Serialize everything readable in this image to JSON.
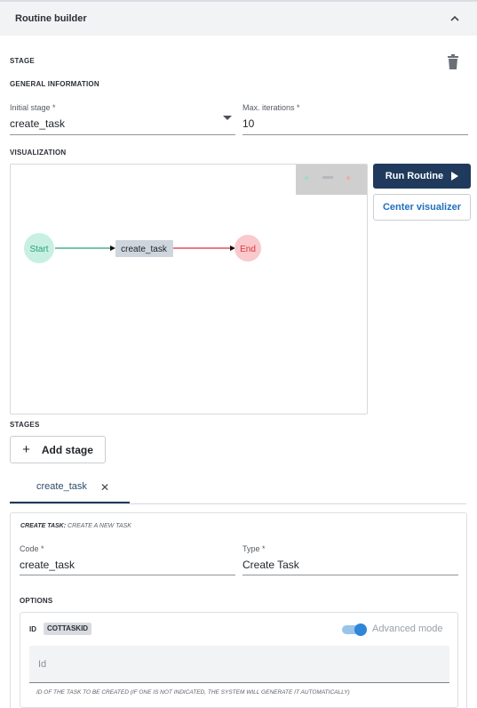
{
  "header": {
    "title": "Routine builder",
    "collapse_icon": "chevron-up-icon"
  },
  "stage": {
    "section_label": "STAGE",
    "general_label": "GENERAL INFORMATION",
    "initial_stage": {
      "label": "Initial stage *",
      "value": "create_task"
    },
    "max_iterations": {
      "label": "Max. iterations *",
      "value": "10"
    },
    "delete_icon": "trash-icon"
  },
  "visualization": {
    "label": "VISUALIZATION",
    "nodes": {
      "start": "Start",
      "task": "create_task",
      "end": "End"
    },
    "colors": {
      "start_fill": "#c8f0e2",
      "start_text": "#2aa37a",
      "end_fill": "#f9c9cc",
      "end_text": "#d9363e",
      "task_fill": "#cfd5dc",
      "edge_start": "#20a07a",
      "edge_end": "#e02a3c"
    }
  },
  "actions": {
    "run_label": "Run Routine",
    "center_label": "Center visualizer"
  },
  "stages": {
    "label": "STAGES",
    "add_label": "Add stage",
    "tabs": [
      {
        "label": "create_task"
      }
    ]
  },
  "card": {
    "title_bold": "CREATE TASK:",
    "title_rest": " CREATE A NEW TASK",
    "code": {
      "label": "Code *",
      "value": "create_task"
    },
    "type": {
      "label": "Type *",
      "value": "Create Task"
    },
    "options_label": "OPTIONS",
    "option": {
      "id_label": "ID",
      "chip": "COTTASKID",
      "advanced_label": "Advanced mode",
      "advanced_on": true,
      "placeholder": "Id",
      "help": "ID OF THE TASK TO BE CREATED (IF ONE IS NOT INDICATED, THE SYSTEM WILL GENERATE IT AUTOMATICALLY)"
    }
  },
  "accent": "#1f3a5c"
}
